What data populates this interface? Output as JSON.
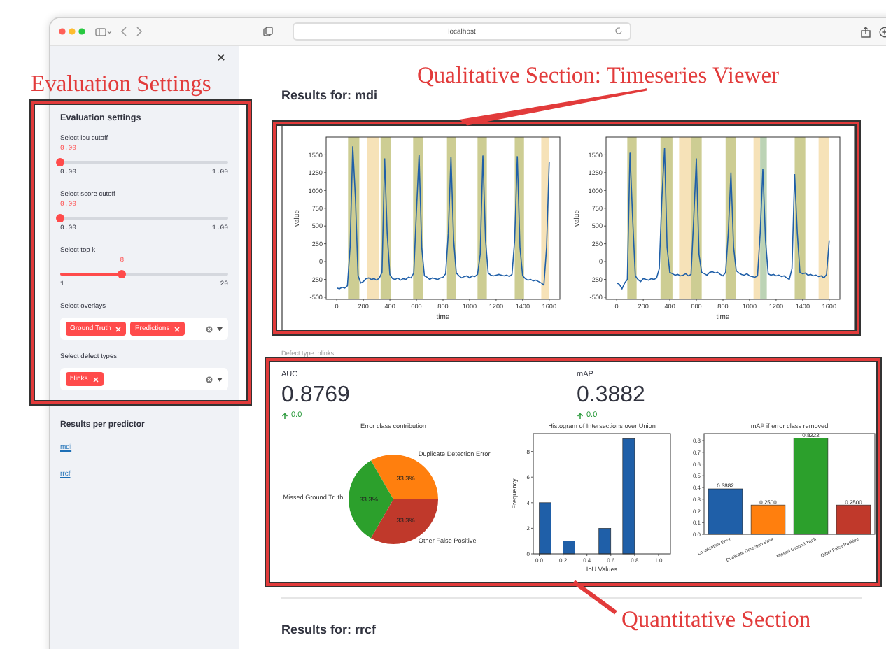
{
  "browser": {
    "url": "localhost"
  },
  "sidebar": {
    "settings": {
      "title": "Evaluation settings",
      "sliders": [
        {
          "label": "Select iou cutoff",
          "value": "0.00",
          "min": "0.00",
          "max": "1.00",
          "level": 0
        },
        {
          "label": "Select score cutoff",
          "value": "0.00",
          "min": "0.00",
          "max": "1.00",
          "level": 0
        },
        {
          "label": "Select top k",
          "value": "8",
          "min": "1",
          "max": "20",
          "level": 0.368
        }
      ],
      "multiselects": [
        {
          "label": "Select overlays",
          "tags": [
            "Ground Truth",
            "Predictions"
          ]
        },
        {
          "label": "Select defect types",
          "tags": [
            "blinks"
          ]
        }
      ]
    },
    "results_heading": "Results per predictor",
    "links": [
      "mdi",
      "rrcf"
    ]
  },
  "results": [
    {
      "heading": "Results for: mdi",
      "timeseries": [
        {
          "chart_data": {
            "type": "line",
            "xlabel": "time",
            "ylabel": "value",
            "xlim": [
              -80,
              1680
            ],
            "ylim": [
              -530,
              1750
            ],
            "xticks": [
              0,
              200,
              400,
              600,
              800,
              1000,
              1200,
              1400,
              1600
            ],
            "yticks": [
              -500,
              -250,
              0,
              250,
              500,
              750,
              1000,
              1250,
              1500
            ],
            "x": [
              0,
              20,
              40,
              60,
              80,
              100,
              120,
              140,
              160,
              180,
              200,
              220,
              240,
              260,
              280,
              300,
              320,
              340,
              360,
              380,
              400,
              420,
              440,
              460,
              480,
              500,
              520,
              540,
              560,
              580,
              600,
              620,
              640,
              660,
              680,
              700,
              720,
              740,
              760,
              780,
              800,
              820,
              840,
              860,
              880,
              900,
              920,
              940,
              960,
              980,
              1000,
              1020,
              1040,
              1060,
              1080,
              1100,
              1120,
              1140,
              1160,
              1180,
              1200,
              1220,
              1240,
              1260,
              1280,
              1300,
              1320,
              1340,
              1360,
              1380,
              1400,
              1420,
              1440,
              1460,
              1480,
              1500,
              1520,
              1540,
              1560,
              1580,
              1600
            ],
            "series": [
              {
                "color": "#1f5fa8",
                "values": [
                  -370,
                  -380,
                  -360,
                  -370,
                  -340,
                  200,
                  1620,
                  900,
                  -200,
                  -300,
                  -280,
                  -240,
                  -230,
                  -250,
                  -240,
                  -260,
                  -230,
                  -150,
                  1450,
                  400,
                  -180,
                  -240,
                  -250,
                  -230,
                  -260,
                  -240,
                  -250,
                  -220,
                  -230,
                  -160,
                  700,
                  1500,
                  200,
                  -200,
                  -220,
                  -250,
                  -230,
                  -240,
                  -250,
                  -230,
                  -220,
                  -170,
                  400,
                  1470,
                  300,
                  -160,
                  -200,
                  -230,
                  -210,
                  -200,
                  -230,
                  -200,
                  -210,
                  -180,
                  100,
                  1490,
                  300,
                  -160,
                  -190,
                  -200,
                  -190,
                  -180,
                  -190,
                  -200,
                  -190,
                  -210,
                  -180,
                  300,
                  1480,
                  200,
                  -200,
                  -240,
                  -260,
                  -250,
                  -270,
                  -260,
                  -280,
                  -300,
                  -330,
                  200,
                  1400
                ]
              }
            ],
            "bands": [
              {
                "axis": "x",
                "from": 85,
                "to": 170,
                "color": "#cdcd93"
              },
              {
                "axis": "x",
                "from": 230,
                "to": 320,
                "color": "#f6e2b8"
              },
              {
                "axis": "x",
                "from": 330,
                "to": 410,
                "color": "#cdcd93"
              },
              {
                "axis": "x",
                "from": 575,
                "to": 650,
                "color": "#cdcd93"
              },
              {
                "axis": "x",
                "from": 830,
                "to": 900,
                "color": "#cdcd93"
              },
              {
                "axis": "x",
                "from": 1060,
                "to": 1130,
                "color": "#cdcd93"
              },
              {
                "axis": "x",
                "from": 1340,
                "to": 1410,
                "color": "#cdcd93"
              },
              {
                "axis": "x",
                "from": 1540,
                "to": 1600,
                "color": "#f6e2b8"
              }
            ]
          }
        },
        {
          "chart_data": {
            "type": "line",
            "xlabel": "time",
            "ylabel": "value",
            "xlim": [
              -80,
              1680
            ],
            "ylim": [
              -530,
              1750
            ],
            "xticks": [
              0,
              200,
              400,
              600,
              800,
              1000,
              1200,
              1400,
              1600
            ],
            "yticks": [
              -500,
              -250,
              0,
              250,
              500,
              750,
              1000,
              1250,
              1500
            ],
            "x": [
              0,
              20,
              40,
              60,
              80,
              100,
              120,
              140,
              160,
              180,
              200,
              220,
              240,
              260,
              280,
              300,
              320,
              340,
              360,
              380,
              400,
              420,
              440,
              460,
              480,
              500,
              520,
              540,
              560,
              580,
              600,
              620,
              640,
              660,
              680,
              700,
              720,
              740,
              760,
              780,
              800,
              820,
              840,
              860,
              880,
              900,
              920,
              940,
              960,
              980,
              1000,
              1020,
              1040,
              1060,
              1080,
              1100,
              1120,
              1140,
              1160,
              1180,
              1200,
              1220,
              1240,
              1260,
              1280,
              1300,
              1320,
              1340,
              1360,
              1380,
              1400,
              1420,
              1440,
              1460,
              1480,
              1500,
              1520,
              1540,
              1560,
              1580,
              1600
            ],
            "series": [
              {
                "color": "#1f5fa8",
                "values": [
                  -300,
                  -320,
                  -380,
                  -300,
                  -250,
                  1530,
                  600,
                  -200,
                  -250,
                  -280,
                  -240,
                  -250,
                  -260,
                  -240,
                  -250,
                  -230,
                  -100,
                  900,
                  1600,
                  200,
                  -150,
                  -170,
                  -190,
                  -180,
                  -200,
                  -190,
                  -170,
                  -200,
                  -180,
                  600,
                  1450,
                  100,
                  -150,
                  -170,
                  -190,
                  -150,
                  -140,
                  -160,
                  -150,
                  -180,
                  -200,
                  -150,
                  400,
                  1250,
                  200,
                  -130,
                  -160,
                  -180,
                  -190,
                  -170,
                  -200,
                  -210,
                  -220,
                  -200,
                  400,
                  1300,
                  300,
                  -170,
                  -190,
                  -180,
                  -200,
                  -190,
                  -210,
                  -200,
                  -230,
                  -250,
                  -100,
                  1230,
                  400,
                  -150,
                  -170,
                  -160,
                  -190,
                  -180,
                  -200,
                  -190,
                  -210,
                  -200,
                  -230,
                  -180,
                  300
                ]
              }
            ],
            "bands": [
              {
                "axis": "x",
                "from": 80,
                "to": 150,
                "color": "#cdcd93"
              },
              {
                "axis": "x",
                "from": 330,
                "to": 420,
                "color": "#cdcd93"
              },
              {
                "axis": "x",
                "from": 470,
                "to": 560,
                "color": "#f6e2b8"
              },
              {
                "axis": "x",
                "from": 560,
                "to": 640,
                "color": "#cdcd93"
              },
              {
                "axis": "x",
                "from": 820,
                "to": 900,
                "color": "#cdcd93"
              },
              {
                "axis": "x",
                "from": 1030,
                "to": 1080,
                "color": "#f6e2b8"
              },
              {
                "axis": "x",
                "from": 1080,
                "to": 1130,
                "color": "#bcd3b5"
              },
              {
                "axis": "x",
                "from": 1340,
                "to": 1420,
                "color": "#cdcd93"
              },
              {
                "axis": "x",
                "from": 1520,
                "to": 1600,
                "color": "#f6e2b8"
              }
            ]
          }
        }
      ],
      "caption": "Defect type: blinks",
      "metrics": [
        {
          "label": "AUC",
          "value": "0.8769",
          "delta": "0.0"
        },
        {
          "label": "mAP",
          "value": "0.3882",
          "delta": "0.0"
        }
      ],
      "charts": [
        {
          "chart_data": {
            "type": "pie",
            "title": "Error class contribution",
            "categories": [
              "Duplicate Detection Error",
              "Missed Ground Truth",
              "Other False Positive"
            ],
            "values": [
              33.3,
              33.3,
              33.3
            ],
            "colors": [
              "#ff7f0e",
              "#2ca02c",
              "#c0392b"
            ],
            "value_labels": [
              "33.3%",
              "33.3%",
              "33.3%"
            ]
          }
        },
        {
          "chart_data": {
            "type": "bar",
            "title": "Histogram of Intersections over Union",
            "xlabel": "IoU Values",
            "ylabel": "Frequency",
            "x": [
              0.05,
              0.25,
              0.55,
              0.75
            ],
            "series": [
              {
                "color": "#1f5fa8",
                "values": [
                  4,
                  1,
                  2,
                  9
                ]
              }
            ],
            "xlim": [
              -0.05,
              1.1
            ],
            "ylim": [
              0,
              9.4
            ],
            "xticks": [
              {
                "value": 0,
                "label": "0.0"
              },
              {
                "value": 0.2,
                "label": "0.2"
              },
              {
                "value": 0.4,
                "label": "0.4"
              },
              {
                "value": 0.6,
                "label": "0.6"
              },
              {
                "value": 0.8,
                "label": "0.8"
              },
              {
                "value": 1,
                "label": "1.0"
              }
            ],
            "yticks": [
              0,
              2,
              4,
              6,
              8
            ]
          }
        },
        {
          "chart_data": {
            "type": "bar",
            "title": "mAP if error class removed",
            "categories": [
              "Localization Error",
              "Duplicate Detection Error",
              "Missed Ground Truth",
              "Other False Positive"
            ],
            "values": [
              0.3882,
              0.25,
              0.8222,
              0.25
            ],
            "ylim": [
              0,
              0.86
            ],
            "yticks": [
              {
                "value": 0,
                "label": "0.0"
              },
              {
                "value": 0.1,
                "label": "0.1"
              },
              {
                "value": 0.2,
                "label": "0.2"
              },
              {
                "value": 0.3,
                "label": "0.3"
              },
              {
                "value": 0.4,
                "label": "0.4"
              },
              {
                "value": 0.5,
                "label": "0.5"
              },
              {
                "value": 0.6,
                "label": "0.6"
              },
              {
                "value": 0.7,
                "label": "0.7"
              },
              {
                "value": 0.8,
                "label": "0.8"
              }
            ],
            "colors": [
              "#1f5fa8",
              "#ff7f0e",
              "#2ca02c",
              "#c0392b"
            ],
            "value_labels": [
              "0.3882",
              "0.2500",
              "0.8222",
              "0.2500"
            ]
          }
        }
      ]
    },
    {
      "heading": "Results for: rrcf"
    }
  ],
  "annotations": {
    "settings_label": "Evaluation Settings",
    "qualitative_label": "Qualitative Section: Timeseries Viewer",
    "quantitative_label": "Quantitative Section"
  }
}
